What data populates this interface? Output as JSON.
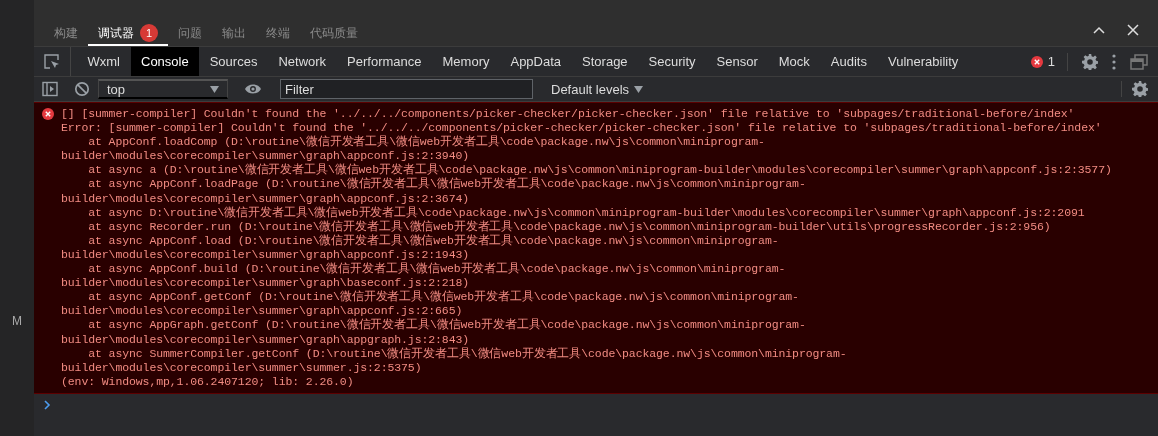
{
  "side_strip": {
    "letter": "M"
  },
  "top_tabs": [
    {
      "label": "构建",
      "selected": false
    },
    {
      "label": "调试器",
      "selected": true,
      "badge": "1"
    },
    {
      "label": "问题",
      "selected": false
    },
    {
      "label": "输出",
      "selected": false
    },
    {
      "label": "终端",
      "selected": false
    },
    {
      "label": "代码质量",
      "selected": false
    }
  ],
  "panel_tabs": [
    {
      "label": "Wxml",
      "selected": false
    },
    {
      "label": "Console",
      "selected": true
    },
    {
      "label": "Sources",
      "selected": false
    },
    {
      "label": "Network",
      "selected": false
    },
    {
      "label": "Performance",
      "selected": false
    },
    {
      "label": "Memory",
      "selected": false
    },
    {
      "label": "AppData",
      "selected": false
    },
    {
      "label": "Storage",
      "selected": false
    },
    {
      "label": "Security",
      "selected": false
    },
    {
      "label": "Sensor",
      "selected": false
    },
    {
      "label": "Mock",
      "selected": false
    },
    {
      "label": "Audits",
      "selected": false
    },
    {
      "label": "Vulnerability",
      "selected": false
    }
  ],
  "error_count": "1",
  "toolbar": {
    "context": "top",
    "filter": {
      "placeholder": "Filter"
    },
    "levels": "Default levels"
  },
  "console": {
    "messages": [
      {
        "kind": "error",
        "summary": "[] [summer-compiler] Couldn't found the '../../../components/picker-checker/picker-checker.json' file relative to 'subpages/traditional-before/index'",
        "lines": [
          "Error: [summer-compiler] Couldn't found the '../../../components/picker-checker/picker-checker.json' file relative to 'subpages/traditional-before/index'",
          "    at AppConf.loadComp (D:\\routine\\微信开发者工具\\微信web开发者工具\\code\\package.nw\\js\\common\\miniprogram-",
          "builder\\modules\\corecompiler\\summer\\graph\\appconf.js:2:3940)",
          "    at async a (D:\\routine\\微信开发者工具\\微信web开发者工具\\code\\package.nw\\js\\common\\miniprogram-builder\\modules\\corecompiler\\summer\\graph\\appconf.js:2:3577)",
          "    at async AppConf.loadPage (D:\\routine\\微信开发者工具\\微信web开发者工具\\code\\package.nw\\js\\common\\miniprogram-",
          "builder\\modules\\corecompiler\\summer\\graph\\appconf.js:2:3674)",
          "    at async D:\\routine\\微信开发者工具\\微信web开发者工具\\code\\package.nw\\js\\common\\miniprogram-builder\\modules\\corecompiler\\summer\\graph\\appconf.js:2:2091",
          "    at async Recorder.run (D:\\routine\\微信开发者工具\\微信web开发者工具\\code\\package.nw\\js\\common\\miniprogram-builder\\utils\\progressRecorder.js:2:956)",
          "    at async AppConf.load (D:\\routine\\微信开发者工具\\微信web开发者工具\\code\\package.nw\\js\\common\\miniprogram-",
          "builder\\modules\\corecompiler\\summer\\graph\\appconf.js:2:1943)",
          "    at async AppConf.build (D:\\routine\\微信开发者工具\\微信web开发者工具\\code\\package.nw\\js\\common\\miniprogram-",
          "builder\\modules\\corecompiler\\summer\\graph\\baseconf.js:2:218)",
          "    at async AppConf.getConf (D:\\routine\\微信开发者工具\\微信web开发者工具\\code\\package.nw\\js\\common\\miniprogram-",
          "builder\\modules\\corecompiler\\summer\\graph\\appconf.js:2:665)",
          "    at async AppGraph.getConf (D:\\routine\\微信开发者工具\\微信web开发者工具\\code\\package.nw\\js\\common\\miniprogram-",
          "builder\\modules\\corecompiler\\summer\\graph\\appgraph.js:2:843)",
          "    at async SummerCompiler.getConf (D:\\routine\\微信开发者工具\\微信web开发者工具\\code\\package.nw\\js\\common\\miniprogram-",
          "builder\\modules\\corecompiler\\summer\\summer.js:2:5375)",
          "(env: Windows,mp,1.06.2407120; lib: 2.26.0)"
        ]
      }
    ]
  }
}
